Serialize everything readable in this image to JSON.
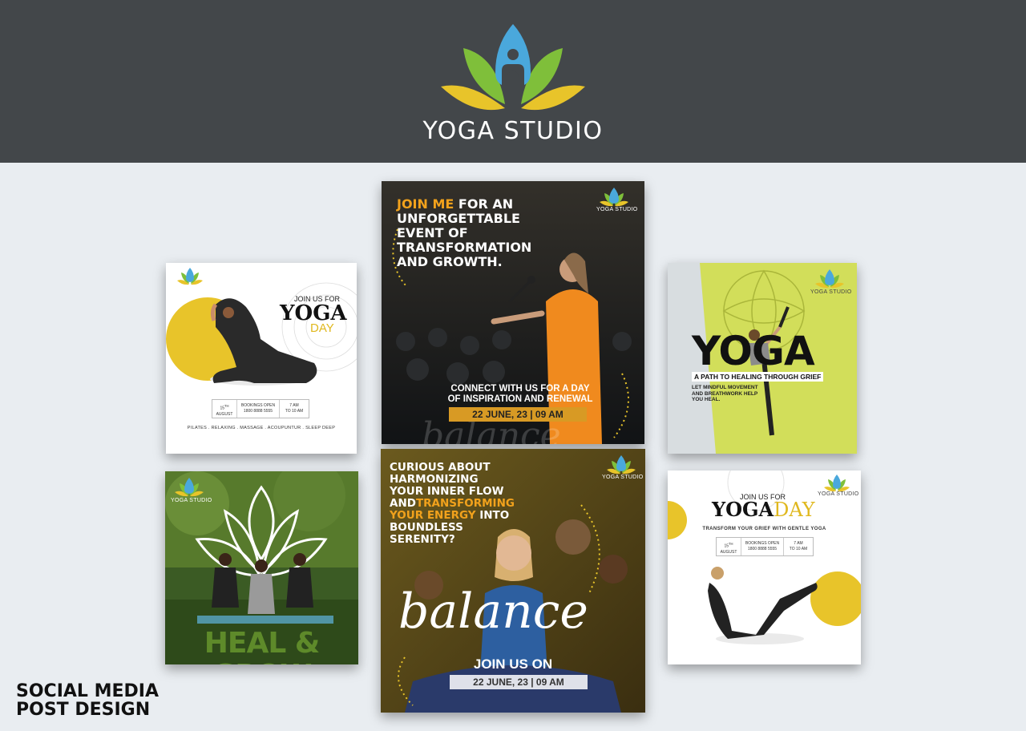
{
  "brand": {
    "name": "YOGA STUDIO",
    "colors": {
      "header": "#43474a",
      "background": "#e9edf1",
      "blue": "#4aa8dc",
      "green": "#7fbf3a",
      "yellow": "#e8c42a",
      "orange": "#f2a21c"
    }
  },
  "footer": {
    "line1": "SOCIAL MEDIA",
    "line2": "POST DESIGN"
  },
  "cards": {
    "card1": {
      "kicker": "JOIN US FOR",
      "headline": "YOGA",
      "subhead": "DAY",
      "date_day": "15",
      "date_sup": "TH",
      "date_month": "AUGUST",
      "bookings_label": "BOOKINGS OPEN",
      "phone": "1800 8888 5555",
      "time1": "7 AM",
      "time2": "TO 10 AM",
      "tags": "PILATES . RELAXING . MASSAGE . ACOUPUNTUR . SLEEP DEEP",
      "logo_text": "YOGA STUDIO"
    },
    "card2": {
      "headline_accent": "JOIN ME",
      "headline_rest_1": "FOR AN",
      "headline_line2": "UNFORGETTABLE",
      "headline_line3": "EVENT OF",
      "headline_line4": "TRANSFORMATION",
      "headline_line5": "AND GROWTH.",
      "connect_1": "CONNECT WITH US FOR A DAY",
      "connect_2": "OF INSPIRATION AND RENEWAL",
      "date": "22 JUNE, 23 | 09 AM",
      "script": "balance",
      "logo_text": "YOGA STUDIO"
    },
    "card3": {
      "headline": "YOGA",
      "tagline": "A PATH TO HEALING THROUGH GRIEF",
      "body_1": "LET MINDFUL MOVEMENT",
      "body_2": "AND BREATHWORK HELP",
      "body_3": "YOU HEAL.",
      "logo_text": "YOGA STUDIO"
    },
    "card4": {
      "headline": "HEAL & GROW",
      "logo_text": "YOGA STUDIO"
    },
    "card5": {
      "line1": "CURIOUS ABOUT",
      "line2": "HARMONIZING",
      "line3": "YOUR INNER FLOW",
      "line4_a": "AND",
      "line4_b": "TRANSFORMING",
      "line5_a": "YOUR ENERGY",
      "line5_b": "INTO",
      "line6": "BOUNDLESS",
      "line7": "SERENITY?",
      "script": "balance",
      "join": "JOIN US ON",
      "date": "22 JUNE, 23 | 09 AM",
      "logo_text": "YOGA STUDIO"
    },
    "card6": {
      "kicker": "JOIN US FOR",
      "headline_a": "YOGA",
      "headline_b": "DAY",
      "tagline": "TRANSFORM YOUR GRIEF WITH GENTLE YOGA",
      "date_day": "15",
      "date_sup": "TH",
      "date_month": "AUGUST",
      "bookings_label": "BOOKINGS OPEN",
      "phone": "1800 8888 5555",
      "time1": "7 AM",
      "time2": "TO 10 AM",
      "logo_text": "YOGA STUDIO"
    }
  }
}
